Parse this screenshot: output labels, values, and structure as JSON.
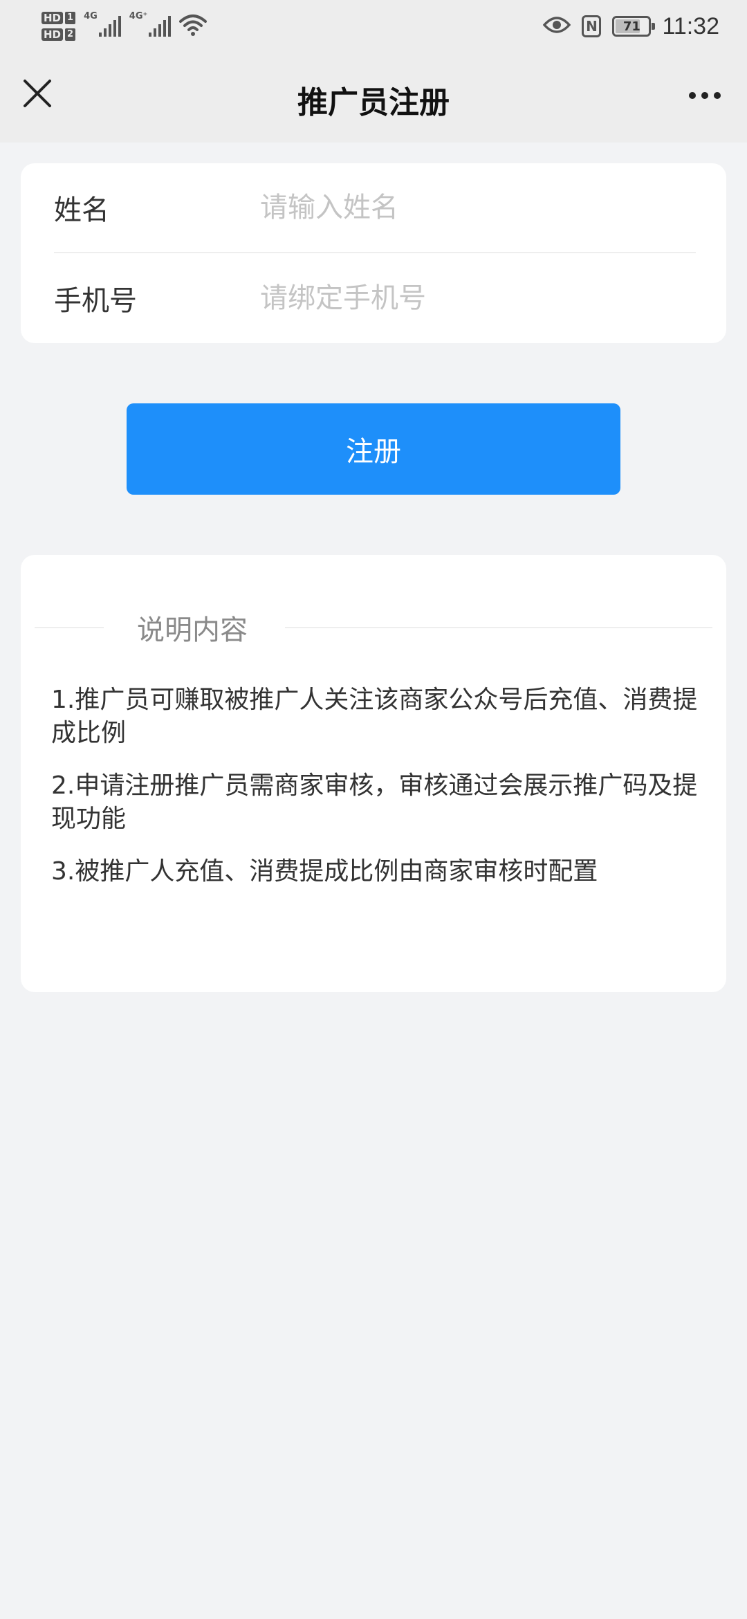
{
  "status_bar": {
    "hd1": "HD",
    "hd1_num": "1",
    "hd2": "HD",
    "hd2_num": "2",
    "net1": "4G",
    "net2": "4G⁺",
    "battery": "71",
    "time": "11:32",
    "icons": [
      "wifi-icon",
      "eye-icon",
      "nfc-icon",
      "battery-icon"
    ]
  },
  "nav": {
    "title": "推广员注册",
    "close_icon": "close-icon",
    "more_icon": "more-icon"
  },
  "form": {
    "name_label": "姓名",
    "name_placeholder": "请输入姓名",
    "phone_label": "手机号",
    "phone_placeholder": "请绑定手机号"
  },
  "submit_label": "注册",
  "info": {
    "title": "说明内容",
    "items": [
      "1.推广员可赚取被推广人关注该商家公众号后充值、消费提成比例",
      "2.申请注册推广员需商家审核，审核通过会展示推广码及提现功能",
      "3.被推广人充值、消费提成比例由商家审核时配置"
    ]
  },
  "colors": {
    "primary": "#1e8ffa",
    "background": "#f2f3f5",
    "header": "#ededed"
  }
}
